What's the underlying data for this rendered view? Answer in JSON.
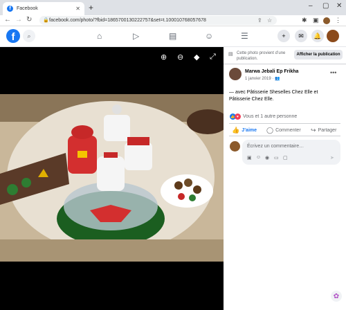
{
  "browser": {
    "tab_title": "Facebook",
    "fav_letter": "f",
    "tab_close": "✕",
    "new_tab": "+",
    "url": "facebook.com/photo/?fbid=1865700130222757&set=t.100010768057678"
  },
  "fb_header": {
    "logo_letter": "f"
  },
  "panel": {
    "notice": "Cette photo provient d’une publication.",
    "show_post": "Afficher la publication",
    "author": "Marwa Jebali Ep Frikha",
    "date": "1 janvier 2019 · ",
    "caption": "— avec Pâtisserie Sheselles Chez Elle et Pâtisserie Chez Elle.",
    "reactions": "Vous et 1 autre personne",
    "actions": {
      "like": "J’aime",
      "comment": "Commenter",
      "share": "Partager"
    },
    "comment_placeholder": "Écrivez un commentaire…"
  },
  "colors": {
    "brand": "#1877f2",
    "love": "#f33e58"
  }
}
